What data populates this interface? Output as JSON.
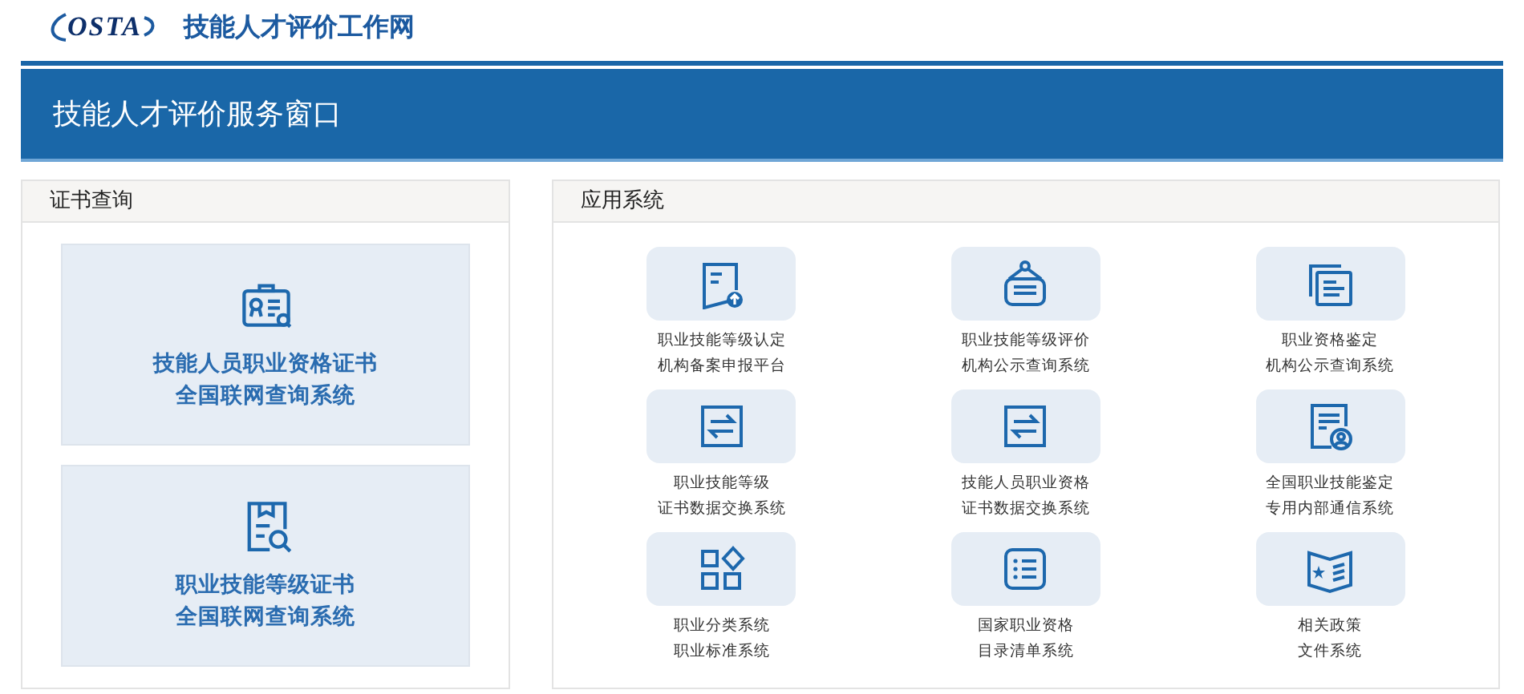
{
  "header": {
    "logo_text": "OSTA",
    "site_title": "技能人才评价工作网"
  },
  "banner": {
    "title": "技能人才评价服务窗口"
  },
  "certificate_panel": {
    "title": "证书查询",
    "cards": [
      {
        "lines": [
          "技能人员职业资格证书",
          "全国联网查询系统"
        ]
      },
      {
        "lines": [
          "职业技能等级证书",
          "全国联网查询系统"
        ]
      }
    ]
  },
  "systems_panel": {
    "title": "应用系统",
    "items": [
      {
        "lines": [
          "职业技能等级认定",
          "机构备案申报平台"
        ]
      },
      {
        "lines": [
          "职业技能等级评价",
          "机构公示查询系统"
        ]
      },
      {
        "lines": [
          "职业资格鉴定",
          "机构公示查询系统"
        ]
      },
      {
        "lines": [
          "职业技能等级",
          "证书数据交换系统"
        ]
      },
      {
        "lines": [
          "技能人员职业资格",
          "证书数据交换系统"
        ]
      },
      {
        "lines": [
          "全国职业技能鉴定",
          "专用内部通信系统"
        ]
      },
      {
        "lines": [
          "职业分类系统",
          "职业标准系统"
        ]
      },
      {
        "lines": [
          "国家职业资格",
          "目录清单系统"
        ]
      },
      {
        "lines": [
          "相关政策",
          "文件系统"
        ]
      }
    ]
  }
}
